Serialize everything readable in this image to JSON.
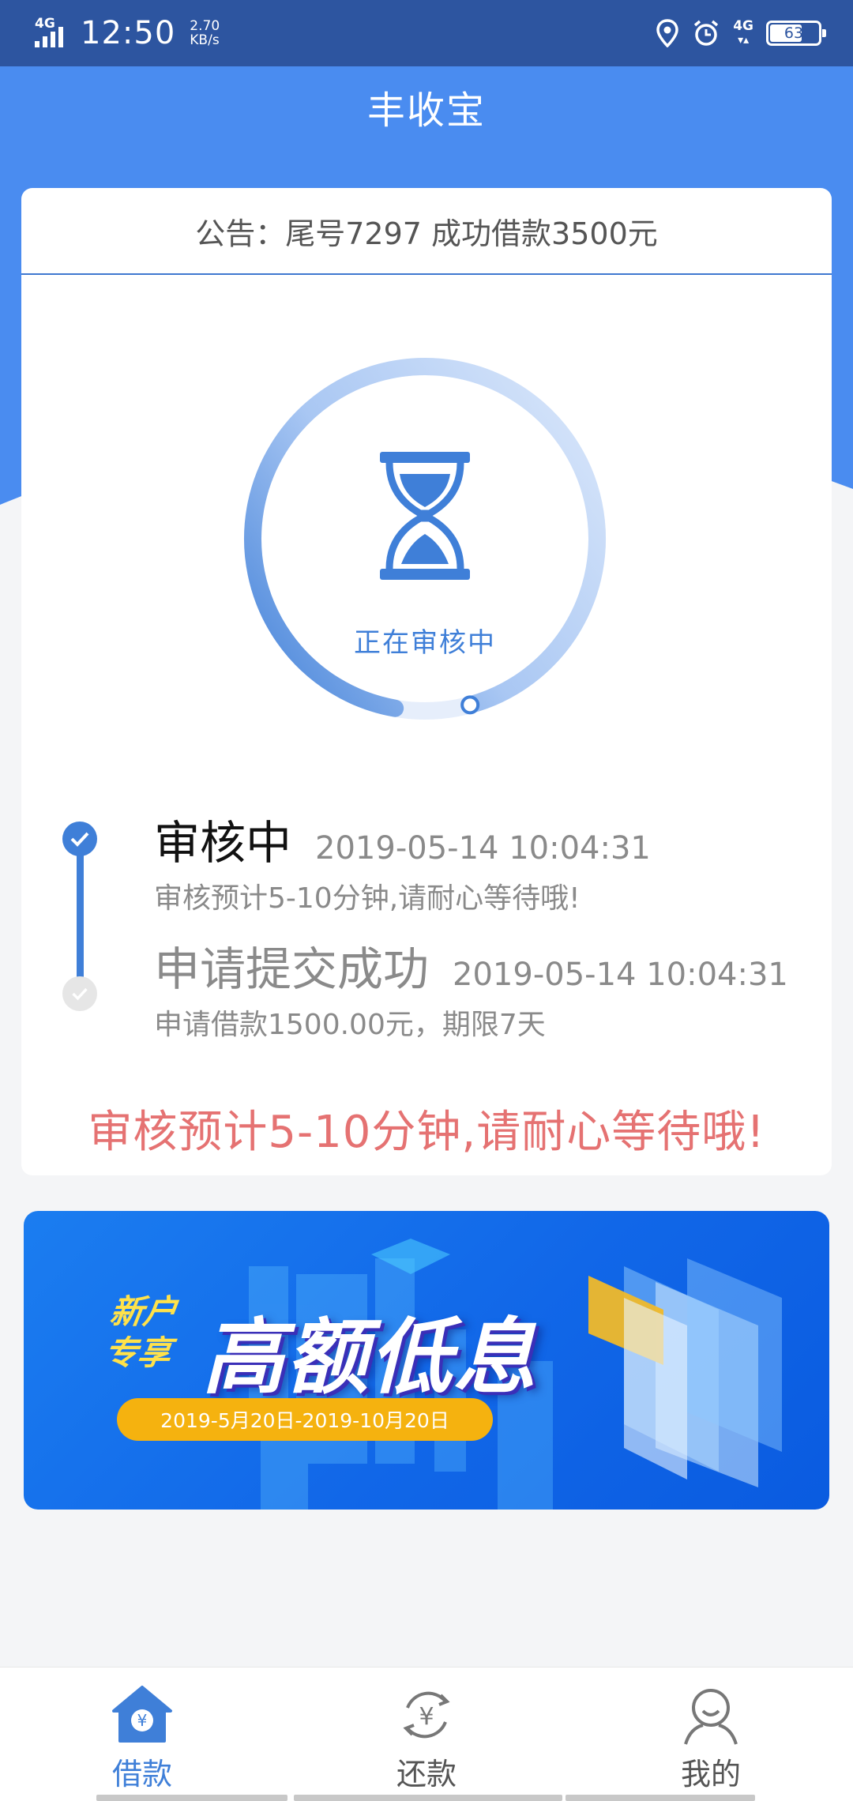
{
  "status_bar": {
    "network": "4G",
    "time": "12:50",
    "speed_value": "2.70",
    "speed_unit": "KB/s",
    "network2": "4G",
    "battery": "63"
  },
  "header": {
    "title": "丰收宝"
  },
  "notice": {
    "text": "公告：尾号7297 成功借款3500元"
  },
  "review": {
    "status_label": "正在审核中",
    "progress_fraction": 0.93
  },
  "timeline": [
    {
      "title": "审核中",
      "time": "2019-05-14 10:04:31",
      "desc": "审核预计5-10分钟,请耐心等待哦!"
    },
    {
      "title": "申请提交成功",
      "time": "2019-05-14 10:04:31",
      "desc": "申请借款1500.00元，期限7天"
    }
  ],
  "red_notice": "审核预计5-10分钟,请耐心等待哦!",
  "banner": {
    "tag_line1": "新户",
    "tag_line2": "专享",
    "headline": "高额低息",
    "date_range": "2019-5月20日-2019-10月20日"
  },
  "nav": [
    {
      "label": "借款",
      "icon": "home-yen-icon",
      "active": true
    },
    {
      "label": "还款",
      "icon": "repay-yen-icon",
      "active": false
    },
    {
      "label": "我的",
      "icon": "user-icon",
      "active": false
    }
  ],
  "colors": {
    "header_blue": "#4a8cf0",
    "status_bar": "#2d55a0",
    "accent": "#3f7fd8",
    "alert_red": "#e57272",
    "banner_yellow": "#f5b20f"
  }
}
